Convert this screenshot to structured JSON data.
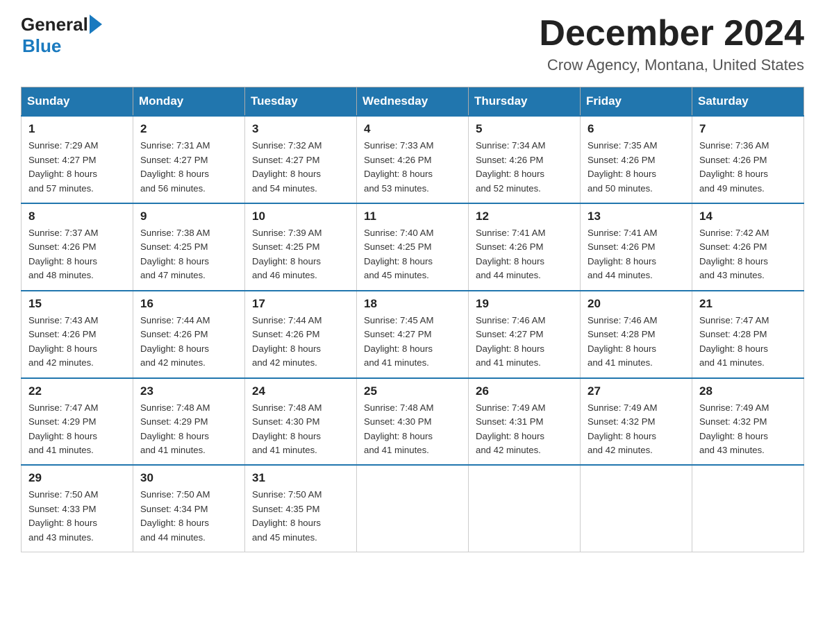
{
  "header": {
    "logo_general": "General",
    "logo_blue": "Blue",
    "month_title": "December 2024",
    "location": "Crow Agency, Montana, United States"
  },
  "days_of_week": [
    "Sunday",
    "Monday",
    "Tuesday",
    "Wednesday",
    "Thursday",
    "Friday",
    "Saturday"
  ],
  "weeks": [
    [
      {
        "day": "1",
        "sunrise": "7:29 AM",
        "sunset": "4:27 PM",
        "daylight": "8 hours and 57 minutes."
      },
      {
        "day": "2",
        "sunrise": "7:31 AM",
        "sunset": "4:27 PM",
        "daylight": "8 hours and 56 minutes."
      },
      {
        "day": "3",
        "sunrise": "7:32 AM",
        "sunset": "4:27 PM",
        "daylight": "8 hours and 54 minutes."
      },
      {
        "day": "4",
        "sunrise": "7:33 AM",
        "sunset": "4:26 PM",
        "daylight": "8 hours and 53 minutes."
      },
      {
        "day": "5",
        "sunrise": "7:34 AM",
        "sunset": "4:26 PM",
        "daylight": "8 hours and 52 minutes."
      },
      {
        "day": "6",
        "sunrise": "7:35 AM",
        "sunset": "4:26 PM",
        "daylight": "8 hours and 50 minutes."
      },
      {
        "day": "7",
        "sunrise": "7:36 AM",
        "sunset": "4:26 PM",
        "daylight": "8 hours and 49 minutes."
      }
    ],
    [
      {
        "day": "8",
        "sunrise": "7:37 AM",
        "sunset": "4:26 PM",
        "daylight": "8 hours and 48 minutes."
      },
      {
        "day": "9",
        "sunrise": "7:38 AM",
        "sunset": "4:25 PM",
        "daylight": "8 hours and 47 minutes."
      },
      {
        "day": "10",
        "sunrise": "7:39 AM",
        "sunset": "4:25 PM",
        "daylight": "8 hours and 46 minutes."
      },
      {
        "day": "11",
        "sunrise": "7:40 AM",
        "sunset": "4:25 PM",
        "daylight": "8 hours and 45 minutes."
      },
      {
        "day": "12",
        "sunrise": "7:41 AM",
        "sunset": "4:26 PM",
        "daylight": "8 hours and 44 minutes."
      },
      {
        "day": "13",
        "sunrise": "7:41 AM",
        "sunset": "4:26 PM",
        "daylight": "8 hours and 44 minutes."
      },
      {
        "day": "14",
        "sunrise": "7:42 AM",
        "sunset": "4:26 PM",
        "daylight": "8 hours and 43 minutes."
      }
    ],
    [
      {
        "day": "15",
        "sunrise": "7:43 AM",
        "sunset": "4:26 PM",
        "daylight": "8 hours and 42 minutes."
      },
      {
        "day": "16",
        "sunrise": "7:44 AM",
        "sunset": "4:26 PM",
        "daylight": "8 hours and 42 minutes."
      },
      {
        "day": "17",
        "sunrise": "7:44 AM",
        "sunset": "4:26 PM",
        "daylight": "8 hours and 42 minutes."
      },
      {
        "day": "18",
        "sunrise": "7:45 AM",
        "sunset": "4:27 PM",
        "daylight": "8 hours and 41 minutes."
      },
      {
        "day": "19",
        "sunrise": "7:46 AM",
        "sunset": "4:27 PM",
        "daylight": "8 hours and 41 minutes."
      },
      {
        "day": "20",
        "sunrise": "7:46 AM",
        "sunset": "4:28 PM",
        "daylight": "8 hours and 41 minutes."
      },
      {
        "day": "21",
        "sunrise": "7:47 AM",
        "sunset": "4:28 PM",
        "daylight": "8 hours and 41 minutes."
      }
    ],
    [
      {
        "day": "22",
        "sunrise": "7:47 AM",
        "sunset": "4:29 PM",
        "daylight": "8 hours and 41 minutes."
      },
      {
        "day": "23",
        "sunrise": "7:48 AM",
        "sunset": "4:29 PM",
        "daylight": "8 hours and 41 minutes."
      },
      {
        "day": "24",
        "sunrise": "7:48 AM",
        "sunset": "4:30 PM",
        "daylight": "8 hours and 41 minutes."
      },
      {
        "day": "25",
        "sunrise": "7:48 AM",
        "sunset": "4:30 PM",
        "daylight": "8 hours and 41 minutes."
      },
      {
        "day": "26",
        "sunrise": "7:49 AM",
        "sunset": "4:31 PM",
        "daylight": "8 hours and 42 minutes."
      },
      {
        "day": "27",
        "sunrise": "7:49 AM",
        "sunset": "4:32 PM",
        "daylight": "8 hours and 42 minutes."
      },
      {
        "day": "28",
        "sunrise": "7:49 AM",
        "sunset": "4:32 PM",
        "daylight": "8 hours and 43 minutes."
      }
    ],
    [
      {
        "day": "29",
        "sunrise": "7:50 AM",
        "sunset": "4:33 PM",
        "daylight": "8 hours and 43 minutes."
      },
      {
        "day": "30",
        "sunrise": "7:50 AM",
        "sunset": "4:34 PM",
        "daylight": "8 hours and 44 minutes."
      },
      {
        "day": "31",
        "sunrise": "7:50 AM",
        "sunset": "4:35 PM",
        "daylight": "8 hours and 45 minutes."
      },
      null,
      null,
      null,
      null
    ]
  ]
}
